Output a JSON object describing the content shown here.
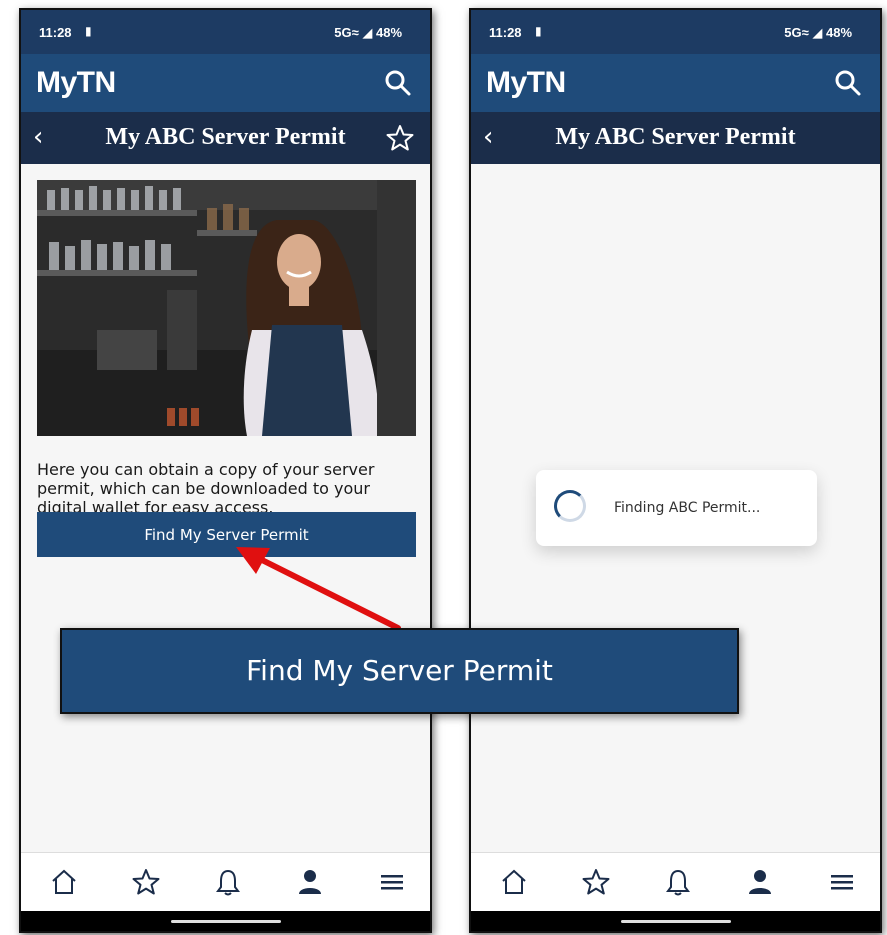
{
  "status_bar": {
    "time": "11:28",
    "network": "5G≈ ◢ 48%"
  },
  "app": {
    "logo": "MyTN"
  },
  "page": {
    "title": "My ABC Server Permit"
  },
  "content": {
    "description": "Here you can obtain a copy of your server permit, which can be downloaded to your digital wallet for easy access.",
    "find_button_label": "Find My Server Permit"
  },
  "loading": {
    "text": "Finding ABC Permit..."
  },
  "callout": {
    "label": "Find My Server Permit"
  },
  "bottom_nav": {
    "items": [
      {
        "icon": "home-icon"
      },
      {
        "icon": "star-icon"
      },
      {
        "icon": "bell-icon"
      },
      {
        "icon": "person-icon"
      },
      {
        "icon": "menu-icon"
      }
    ]
  },
  "colors": {
    "status_bar": "#1d3b63",
    "app_bar": "#1f4b7a",
    "title_bar": "#1b2d4a",
    "button": "#1f4b7a",
    "arrow": "#e01010"
  }
}
